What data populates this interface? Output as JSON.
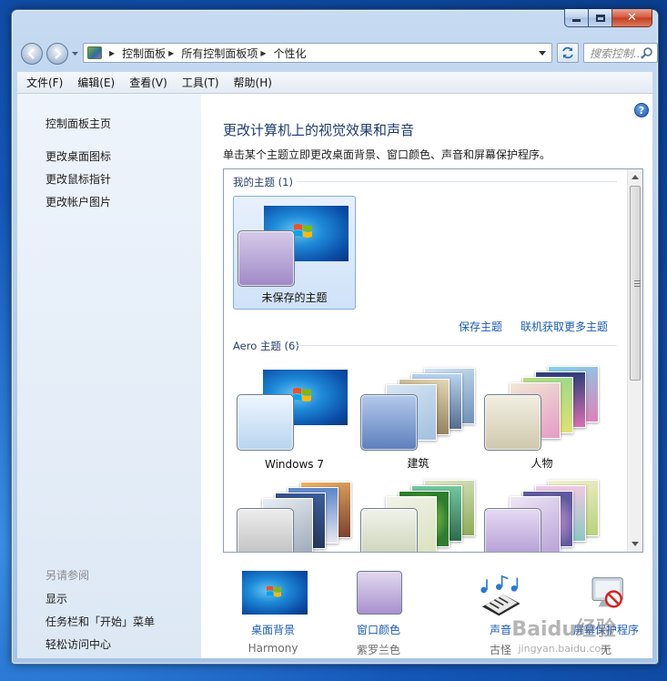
{
  "window": {
    "caption": {
      "close_glyph": "✕"
    }
  },
  "nav": {
    "breadcrumbs": [
      "控制面板",
      "所有控制面板项",
      "个性化"
    ],
    "search_placeholder": "搜索控制..."
  },
  "menu": [
    "文件(F)",
    "编辑(E)",
    "查看(V)",
    "工具(T)",
    "帮助(H)"
  ],
  "sidebar": {
    "home": "控制面板主页",
    "links": [
      "更改桌面图标",
      "更改鼠标指针",
      "更改帐户图片"
    ],
    "see_also_title": "另请参阅",
    "see_also": [
      "显示",
      "任务栏和「开始」菜单",
      "轻松访问中心"
    ]
  },
  "main": {
    "title": "更改计算机上的视觉效果和声音",
    "subtitle": "单击某个主题立即更改桌面背景、窗口颜色、声音和屏幕保护程序。",
    "help_glyph": "?"
  },
  "my_themes": {
    "title": "我的主题 (1)",
    "items": [
      {
        "label": "未保存的主题",
        "swatch": "#b9a8d6",
        "selected": true
      }
    ],
    "save_link": "保存主题",
    "more_link": "联机获取更多主题"
  },
  "aero_themes": {
    "title": "Aero 主题 (6)",
    "items": [
      {
        "label": "Windows 7",
        "swatch": "#c4dcf3"
      },
      {
        "label": "建筑",
        "swatch": "#7f9fd0"
      },
      {
        "label": "人物",
        "swatch": "#e3dfcf"
      },
      {
        "label": "",
        "swatch": "#d8d8d8"
      },
      {
        "label": "",
        "swatch": "#e2e6d8"
      },
      {
        "label": "",
        "swatch": "#c9b8dd"
      }
    ]
  },
  "bottom": [
    {
      "label": "桌面背景",
      "value": "Harmony"
    },
    {
      "label": "窗口颜色",
      "value": "紫罗兰色"
    },
    {
      "label": "声音",
      "value": "古怪"
    },
    {
      "label": "屏幕保护程序",
      "value": "无"
    }
  ],
  "watermark": {
    "text": "Baidu经验",
    "sub": "jingyan.baidu.com"
  },
  "colors": {
    "link": "#1c5bb7",
    "heading": "#1e3a6f",
    "selection": "#cfe2f8"
  }
}
